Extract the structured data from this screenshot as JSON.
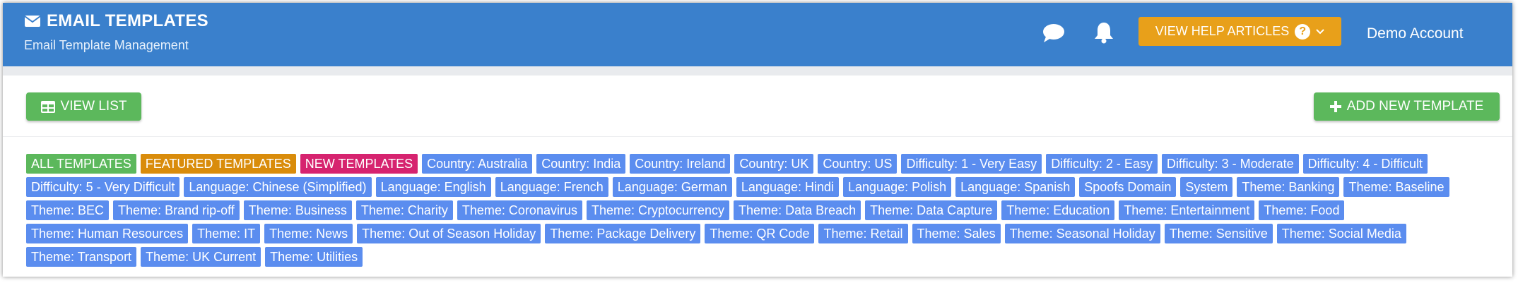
{
  "header": {
    "title": "EMAIL TEMPLATES",
    "subtitle": "Email Template Management",
    "help_label": "VIEW HELP ARTICLES",
    "help_icon_text": "?",
    "account_label": "Demo Account"
  },
  "toolbar": {
    "view_list_label": "VIEW LIST",
    "add_new_label": "ADD NEW TEMPLATE"
  },
  "colors": {
    "header_bg": "#3a80cc",
    "help_btn": "#e8a01a",
    "primary_green": "#5cb85c",
    "tag_blue": "#5b8def",
    "tag_orange": "#d98c0b",
    "tag_pink": "#d6236f"
  },
  "filters": [
    {
      "label": "ALL TEMPLATES",
      "color": "#5cb85c"
    },
    {
      "label": "FEATURED TEMPLATES",
      "color": "#d98c0b"
    },
    {
      "label": "NEW TEMPLATES",
      "color": "#d6236f"
    },
    {
      "label": "Country: Australia",
      "color": "#5b8def"
    },
    {
      "label": "Country: India",
      "color": "#5b8def"
    },
    {
      "label": "Country: Ireland",
      "color": "#5b8def"
    },
    {
      "label": "Country: UK",
      "color": "#5b8def"
    },
    {
      "label": "Country: US",
      "color": "#5b8def"
    },
    {
      "label": "Difficulty: 1 - Very Easy",
      "color": "#5b8def"
    },
    {
      "label": "Difficulty: 2 - Easy",
      "color": "#5b8def"
    },
    {
      "label": "Difficulty: 3 - Moderate",
      "color": "#5b8def"
    },
    {
      "label": "Difficulty: 4 - Difficult",
      "color": "#5b8def"
    },
    {
      "label": "Difficulty: 5 - Very Difficult",
      "color": "#5b8def"
    },
    {
      "label": "Language: Chinese (Simplified)",
      "color": "#5b8def"
    },
    {
      "label": "Language: English",
      "color": "#5b8def"
    },
    {
      "label": "Language: French",
      "color": "#5b8def"
    },
    {
      "label": "Language: German",
      "color": "#5b8def"
    },
    {
      "label": "Language: Hindi",
      "color": "#5b8def"
    },
    {
      "label": "Language: Polish",
      "color": "#5b8def"
    },
    {
      "label": "Language: Spanish",
      "color": "#5b8def"
    },
    {
      "label": "Spoofs Domain",
      "color": "#5b8def"
    },
    {
      "label": "System",
      "color": "#5b8def"
    },
    {
      "label": "Theme: Banking",
      "color": "#5b8def"
    },
    {
      "label": "Theme: Baseline",
      "color": "#5b8def"
    },
    {
      "label": "Theme: BEC",
      "color": "#5b8def"
    },
    {
      "label": "Theme: Brand rip-off",
      "color": "#5b8def"
    },
    {
      "label": "Theme: Business",
      "color": "#5b8def"
    },
    {
      "label": "Theme: Charity",
      "color": "#5b8def"
    },
    {
      "label": "Theme: Coronavirus",
      "color": "#5b8def"
    },
    {
      "label": "Theme: Cryptocurrency",
      "color": "#5b8def"
    },
    {
      "label": "Theme: Data Breach",
      "color": "#5b8def"
    },
    {
      "label": "Theme: Data Capture",
      "color": "#5b8def"
    },
    {
      "label": "Theme: Education",
      "color": "#5b8def"
    },
    {
      "label": "Theme: Entertainment",
      "color": "#5b8def"
    },
    {
      "label": "Theme: Food",
      "color": "#5b8def"
    },
    {
      "label": "Theme: Human Resources",
      "color": "#5b8def"
    },
    {
      "label": "Theme: IT",
      "color": "#5b8def"
    },
    {
      "label": "Theme: News",
      "color": "#5b8def"
    },
    {
      "label": "Theme: Out of Season Holiday",
      "color": "#5b8def"
    },
    {
      "label": "Theme: Package Delivery",
      "color": "#5b8def"
    },
    {
      "label": "Theme: QR Code",
      "color": "#5b8def"
    },
    {
      "label": "Theme: Retail",
      "color": "#5b8def"
    },
    {
      "label": "Theme: Sales",
      "color": "#5b8def"
    },
    {
      "label": "Theme: Seasonal Holiday",
      "color": "#5b8def"
    },
    {
      "label": "Theme: Sensitive",
      "color": "#5b8def"
    },
    {
      "label": "Theme: Social Media",
      "color": "#5b8def"
    },
    {
      "label": "Theme: Transport",
      "color": "#5b8def"
    },
    {
      "label": "Theme: UK Current",
      "color": "#5b8def"
    },
    {
      "label": "Theme: Utilities",
      "color": "#5b8def"
    }
  ]
}
